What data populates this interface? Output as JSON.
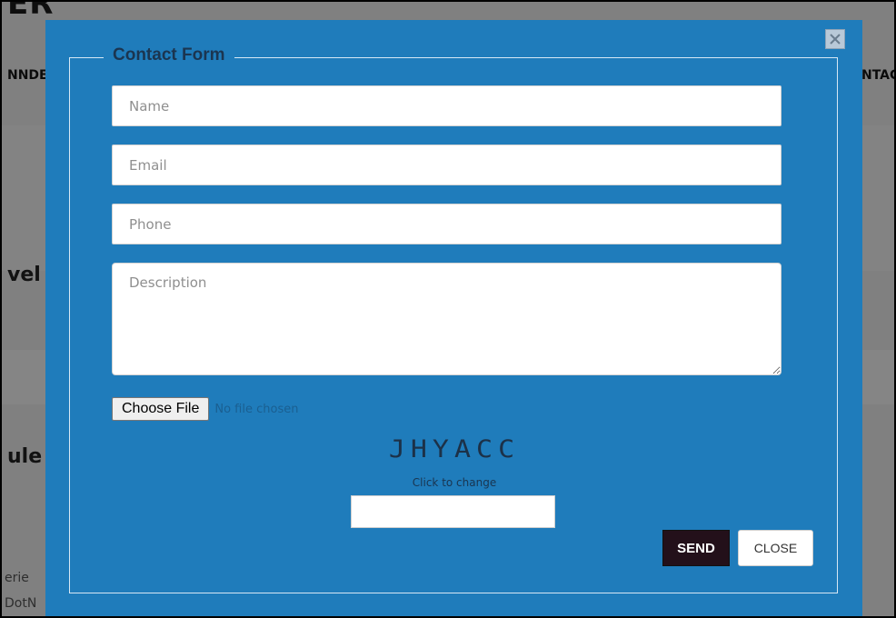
{
  "background": {
    "logo_text": "ER",
    "nav_left": "NNDE",
    "nav_right": "NTAC",
    "heading_1": "vel",
    "heading_2": "ule",
    "text_1": "erie",
    "text_2": "DotN"
  },
  "modal": {
    "title": "Contact Form",
    "close_icon": "close-icon",
    "fields": {
      "name_placeholder": "Name",
      "email_placeholder": "Email",
      "phone_placeholder": "Phone",
      "description_placeholder": "Description"
    },
    "file": {
      "button_label": "Choose File",
      "status": "No file chosen"
    },
    "captcha": {
      "code": "JHYACC",
      "hint": "Click to change",
      "input_value": ""
    },
    "buttons": {
      "send": "SEND",
      "close": "CLOSE"
    }
  },
  "colors": {
    "modal_bg": "#1f7cbb",
    "send_bg": "#23101a"
  }
}
